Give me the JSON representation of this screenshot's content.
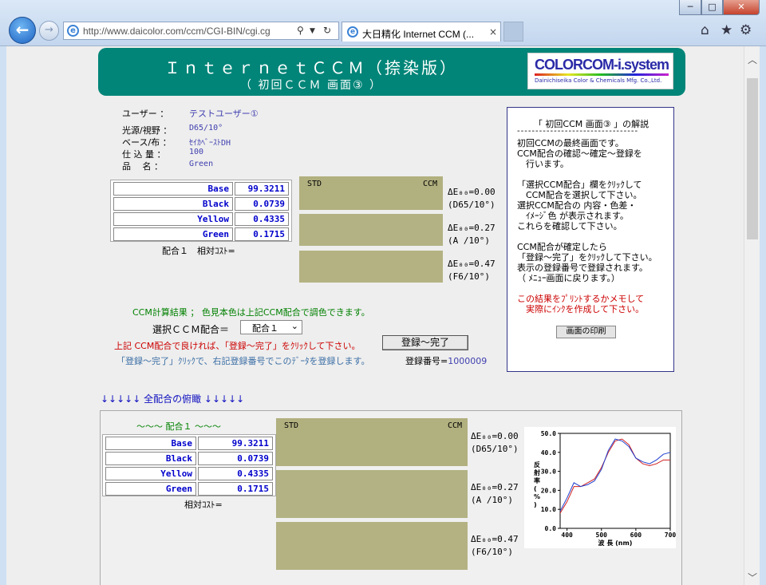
{
  "browser": {
    "url": "http://www.daicolor.com/ccm/CGI-BIN/cgi.cg",
    "tab_title": "大日精化 Internet CCM (...",
    "tab_close": "×",
    "min": "─",
    "max": "□",
    "close": "✕"
  },
  "header": {
    "title": "ＩｎｔｅｒｎｅｔＣＣＭ（捺染版）",
    "subtitle": "（ 初回ＣＣＭ 画面③ ）",
    "logo_main": "COLORCOM-i.system",
    "logo_company": "Dainichiseika Color & Chemicals Mfg. Co.,Ltd."
  },
  "info": {
    "user_label": "ユーザー ：",
    "user_value": "テストユーザー①",
    "light_label": "光源/視野 ：",
    "light_value": "D65/10°",
    "base_label": "ベース/布 ：",
    "base_value": "ｾｲｶﾍﾞｰｽﾄDH",
    "amount_label": "仕 込 量 ：",
    "amount_value": "100",
    "product_label": "品　 名 ：",
    "product_value": "Green"
  },
  "formula": {
    "rows": [
      {
        "name": "Base",
        "value": "99.3211"
      },
      {
        "name": "Black",
        "value": "0.0739"
      },
      {
        "name": "Yellow",
        "value": "0.4335"
      },
      {
        "name": "Green",
        "value": "0.1715"
      }
    ],
    "caption": "配合１　相対ｺｽﾄ="
  },
  "swatches": {
    "std": "STD",
    "ccm": "CCM",
    "de": [
      {
        "value": "ΔE₀₀=0.00",
        "illum": "(D65/10°)"
      },
      {
        "value": "ΔE₀₀=0.27",
        "illum": "(A /10°)"
      },
      {
        "value": "ΔE₀₀=0.47",
        "illum": "(F6/10°)"
      }
    ]
  },
  "explanation": {
    "title": "「 初回CCM 画面③ 」の解説",
    "dash": "---------------------------------",
    "lines": [
      "初回CCMの最終画面です。",
      "CCM配合の確認～確定～登録を",
      "　行います。",
      "",
      "「選択CCM配合」欄をｸﾘｯｸして",
      "　CCM配合を選択して下さい。",
      "選択CCM配合の 内容・色差・",
      "　ｲﾒｰｼﾞ色 が表示されます。",
      "これらを確認して下さい。",
      "",
      "CCM配合が確定したら",
      "「登録～完了」をｸﾘｯｸして下さい。",
      "表示の登録番号で登録されます。",
      "（ ﾒﾆｭｰ画面に戻ります。）"
    ],
    "red_lines": [
      "この結果をﾌﾟﾘﾝﾄするかメモして",
      "　実際にｲﾝｸを作成して下さい。"
    ],
    "print_button": "画面の印刷"
  },
  "selection": {
    "calc_result": "CCM計算結果 ； 色見本色は上記CCM配合で調色できます。",
    "label": "選択ＣＣＭ配合＝",
    "selected": "配合１",
    "red_note": "上記 CCM配合で良ければ、「登録～完了」をｸﾘｯｸして下さい。",
    "register_button": "登録～完了",
    "blue_note": "「登録～完了」ｸﾘｯｸで、右記登録番号でこのﾃﾞｰﾀを登録します。",
    "reg_label": "登録番号=",
    "reg_no": "1000009"
  },
  "overview": {
    "arrows_title": "↓↓↓↓↓ 全配合の俯瞰 ↓↓↓↓↓",
    "formula_title": "～～～ 配合１ ～～～",
    "caption": "相対ｺｽﾄ="
  },
  "colors": {
    "header_bg": "#008578",
    "swatch": "#b1b07f",
    "accent_blue": "#0000cc",
    "note_red": "#cc0000"
  },
  "chart_data": {
    "type": "line",
    "xlabel": "波 長 (nm)",
    "ylabel": "反射率(%)",
    "xlim": [
      380,
      700
    ],
    "ylim": [
      0,
      50
    ],
    "x_ticks": [
      400,
      500,
      600,
      700
    ],
    "y_ticks": [
      0.0,
      10.0,
      20.0,
      30.0,
      40.0,
      50.0
    ],
    "series": [
      {
        "color": "#d02020",
        "x": [
          380,
          400,
          420,
          440,
          460,
          480,
          500,
          520,
          540,
          560,
          580,
          600,
          620,
          640,
          660,
          680,
          700
        ],
        "y": [
          8,
          14,
          22,
          22,
          24,
          26,
          32,
          40,
          46,
          47,
          44,
          37,
          34,
          33,
          34,
          36,
          36
        ]
      },
      {
        "color": "#2040d0",
        "x": [
          380,
          400,
          420,
          440,
          460,
          480,
          500,
          520,
          540,
          560,
          580,
          600,
          620,
          640,
          660,
          680,
          700
        ],
        "y": [
          9,
          16,
          24,
          22,
          23,
          25,
          31,
          41,
          47,
          46,
          43,
          37,
          35,
          34,
          36,
          39,
          40
        ]
      }
    ]
  }
}
